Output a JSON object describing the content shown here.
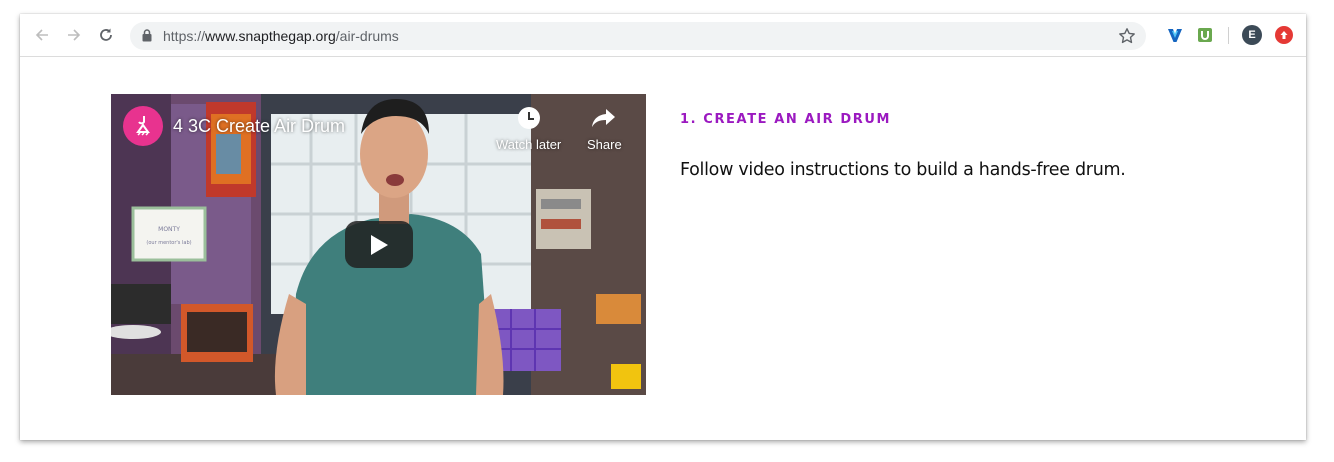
{
  "browser": {
    "url_scheme": "https://",
    "url_host": "www.snapthegap.org",
    "url_path": "/air-drums",
    "profile_initial": "E"
  },
  "video": {
    "title": "4 3C Create Air Drum",
    "watch_later_label": "Watch later",
    "share_label": "Share",
    "whiteboard_line1": "MONTY",
    "whiteboard_line2": "(our mentor's lab)"
  },
  "step": {
    "heading": "1. CREATE AN AIR DRUM",
    "description": "Follow video instructions to build a hands-free drum."
  },
  "colors": {
    "heading": "#9b19c0",
    "logo_pink": "#e8338f",
    "update_red": "#e53935",
    "shirt_teal": "#3f7f7c"
  },
  "icons": {
    "back": "back-arrow-icon",
    "forward": "forward-arrow-icon",
    "reload": "reload-icon",
    "lock": "lock-icon",
    "star": "star-icon",
    "ext1": "v-extension-icon",
    "ext2": "u-extension-icon",
    "update": "update-arrow-icon",
    "play": "play-icon",
    "clock": "clock-icon",
    "share": "share-arrow-icon"
  }
}
